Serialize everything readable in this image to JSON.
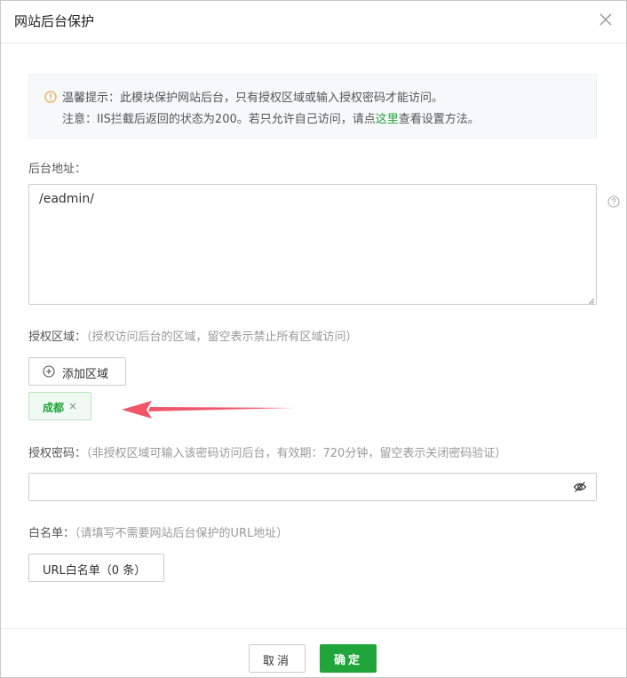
{
  "dialog": {
    "title": "网站后台保护",
    "close_icon": "close-icon"
  },
  "notice": {
    "icon": "warning-icon",
    "line1": "温馨提示：此模块保护网站后台，只有授权区域或输入授权密码才能访问。",
    "line2_prefix": "注意：IIS拦截后返回的状态为200。若只允许自己访问，请点",
    "line2_link": "这里",
    "line2_suffix": "查看设置方法。",
    "link_color": "#20a53a"
  },
  "admin_path": {
    "label": "后台地址：",
    "value": "/eadmin/",
    "help_icon": "question-circle-icon"
  },
  "auth_region": {
    "label": "授权区域：",
    "hint": "（授权访问后台的区域，留空表示禁止所有区域访问）",
    "add_button_label": "添加区域",
    "add_icon": "plus-circle-icon",
    "tags": [
      {
        "name": "成都",
        "remove": "×"
      }
    ]
  },
  "auth_password": {
    "label": "授权密码：",
    "hint": "（非授权区域可输入该密码访问后台，有效期：720分钟，留空表示关闭密码验证）",
    "value": "",
    "visibility_icon": "eye-slash-icon"
  },
  "whitelist": {
    "label": "白名单：",
    "hint": "（请填写不需要网站后台保护的URL地址）",
    "button_label": "URL白名单（0 条）"
  },
  "footer": {
    "cancel_label": "取消",
    "ok_label": "确定"
  },
  "colors": {
    "primary": "#20a53a",
    "annotation_arrow": "#f0566a"
  }
}
